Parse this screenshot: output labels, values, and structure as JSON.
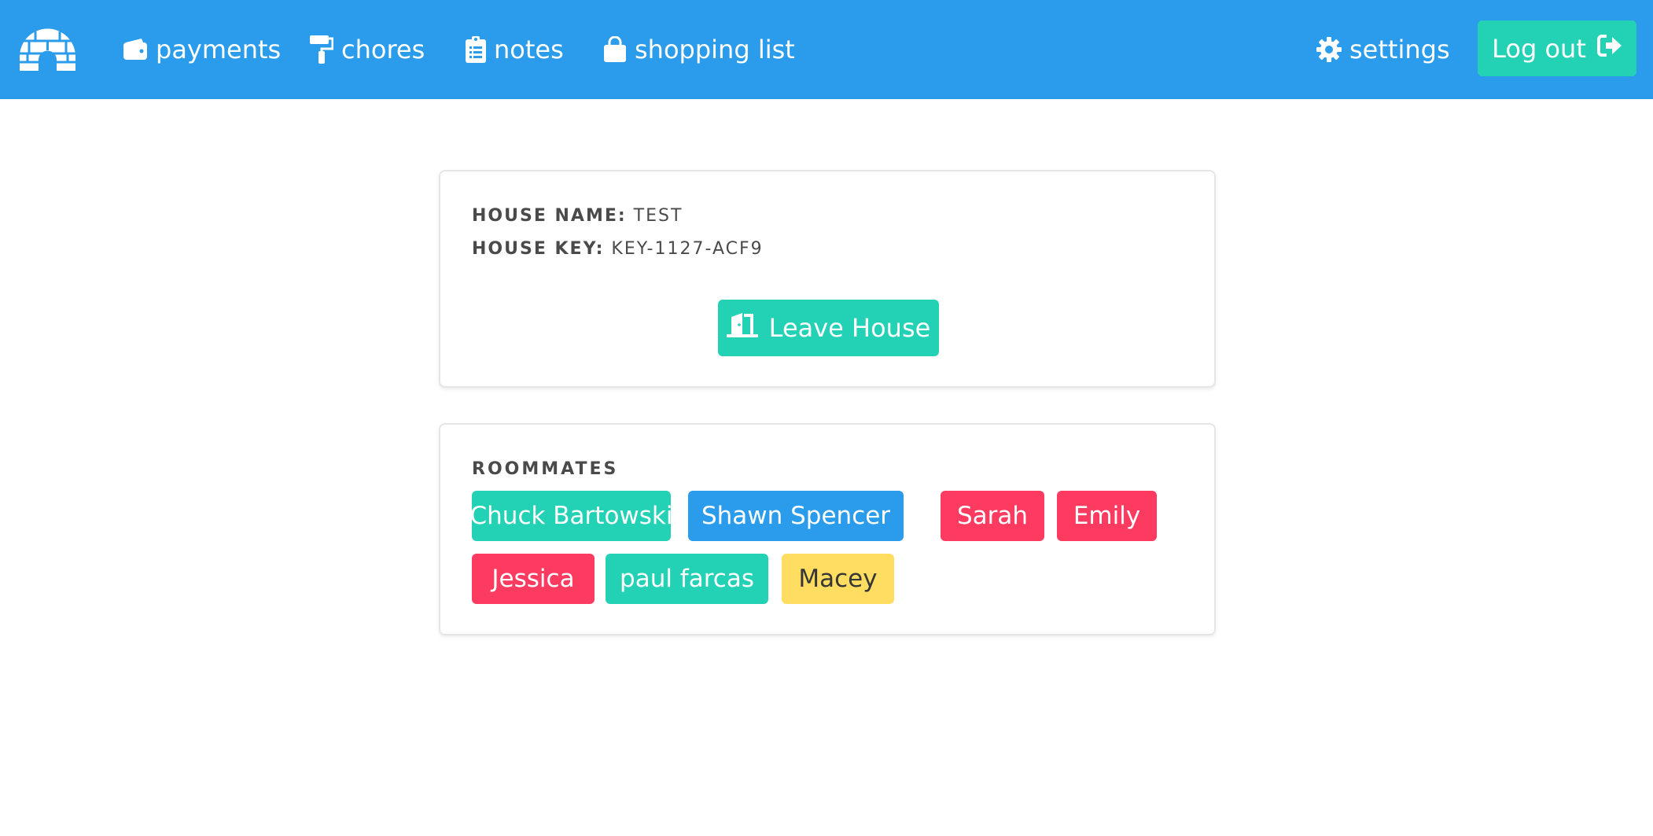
{
  "nav": {
    "logo_icon": "igloo-icon",
    "items": [
      {
        "label": "payments",
        "icon": "wallet-icon"
      },
      {
        "label": "chores",
        "icon": "paint-roller-icon"
      },
      {
        "label": "notes",
        "icon": "clipboard-list-icon"
      },
      {
        "label": "shopping list",
        "icon": "shopping-bag-icon"
      }
    ],
    "settings": {
      "label": "settings",
      "icon": "gear-icon"
    },
    "logout": {
      "label": "Log out",
      "icon": "sign-out-icon"
    }
  },
  "house": {
    "name_label": "HOUSE NAME:",
    "name_value": "TEST",
    "key_label": "HOUSE KEY:",
    "key_value": "KEY-1127-ACF9",
    "leave_button": {
      "label": "Leave House",
      "icon": "door-open-icon"
    }
  },
  "roommates": {
    "title": "ROOMMATES",
    "list": [
      {
        "name": "Chuck Bartowski",
        "color": "#23d2b5"
      },
      {
        "name": "Shawn Spencer",
        "color": "#2b9ceb"
      },
      {
        "name": "Sarah",
        "color": "#fd3a5f"
      },
      {
        "name": "Emily",
        "color": "#fd3a5f"
      },
      {
        "name": "Jessica",
        "color": "#fd3a5f"
      },
      {
        "name": "paul farcas",
        "color": "#23d2b5"
      },
      {
        "name": "Macey",
        "color": "#ffdd60"
      }
    ]
  },
  "colors": {
    "primary": "#2b9ceb",
    "accent": "#23d2b5",
    "danger": "#fd3a5f",
    "warning": "#ffdd60"
  }
}
